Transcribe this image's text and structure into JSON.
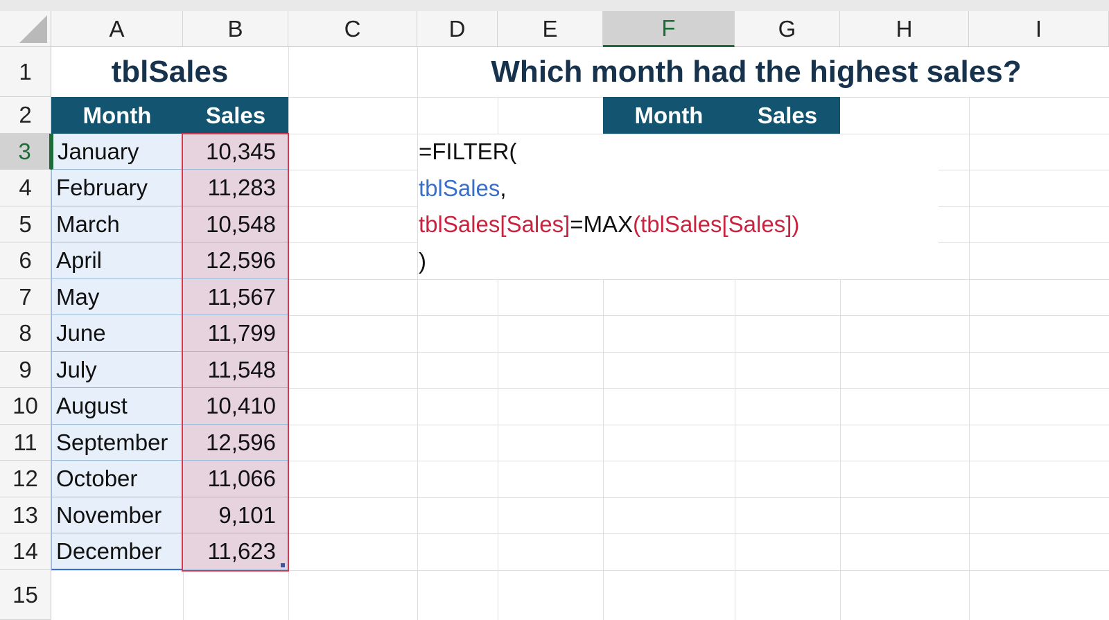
{
  "columns": [
    "A",
    "B",
    "C",
    "D",
    "E",
    "F",
    "G",
    "H",
    "I"
  ],
  "rows": [
    "1",
    "2",
    "3",
    "4",
    "5",
    "6",
    "7",
    "8",
    "9",
    "10",
    "11",
    "12",
    "13",
    "14",
    "15"
  ],
  "selected_column": "F",
  "selected_row": "3",
  "table_title": "tblSales",
  "question": "Which month had the highest sales?",
  "headers": {
    "month": "Month",
    "sales": "Sales"
  },
  "result_headers": {
    "month": "Month",
    "sales": "Sales"
  },
  "table_rows": [
    {
      "month": "January",
      "sales": "10,345"
    },
    {
      "month": "February",
      "sales": "11,283"
    },
    {
      "month": "March",
      "sales": "10,548"
    },
    {
      "month": "April",
      "sales": "12,596"
    },
    {
      "month": "May",
      "sales": "11,567"
    },
    {
      "month": "June",
      "sales": "11,799"
    },
    {
      "month": "July",
      "sales": "11,548"
    },
    {
      "month": "August",
      "sales": "10,410"
    },
    {
      "month": "September",
      "sales": "12,596"
    },
    {
      "month": "October",
      "sales": "11,066"
    },
    {
      "month": "November",
      "sales": "9,101"
    },
    {
      "month": "December",
      "sales": "11,623"
    }
  ],
  "formula": {
    "line1": "=FILTER(",
    "line2_ref": "tblSales",
    "line2_comma": ",",
    "line3_a": "tblSales[Sales]",
    "line3_b": "=MAX",
    "line3_c": "(tblSales[Sales])",
    "line4": ")"
  },
  "colors": {
    "header_fill": "#135570",
    "month_fill": "#e7f0fa",
    "sales_fill": "#e6d3de",
    "title_color": "#17324d",
    "ref_blue": "#3a6fc9",
    "ref_red": "#c9243f",
    "selection_green": "#1e6b3a"
  }
}
